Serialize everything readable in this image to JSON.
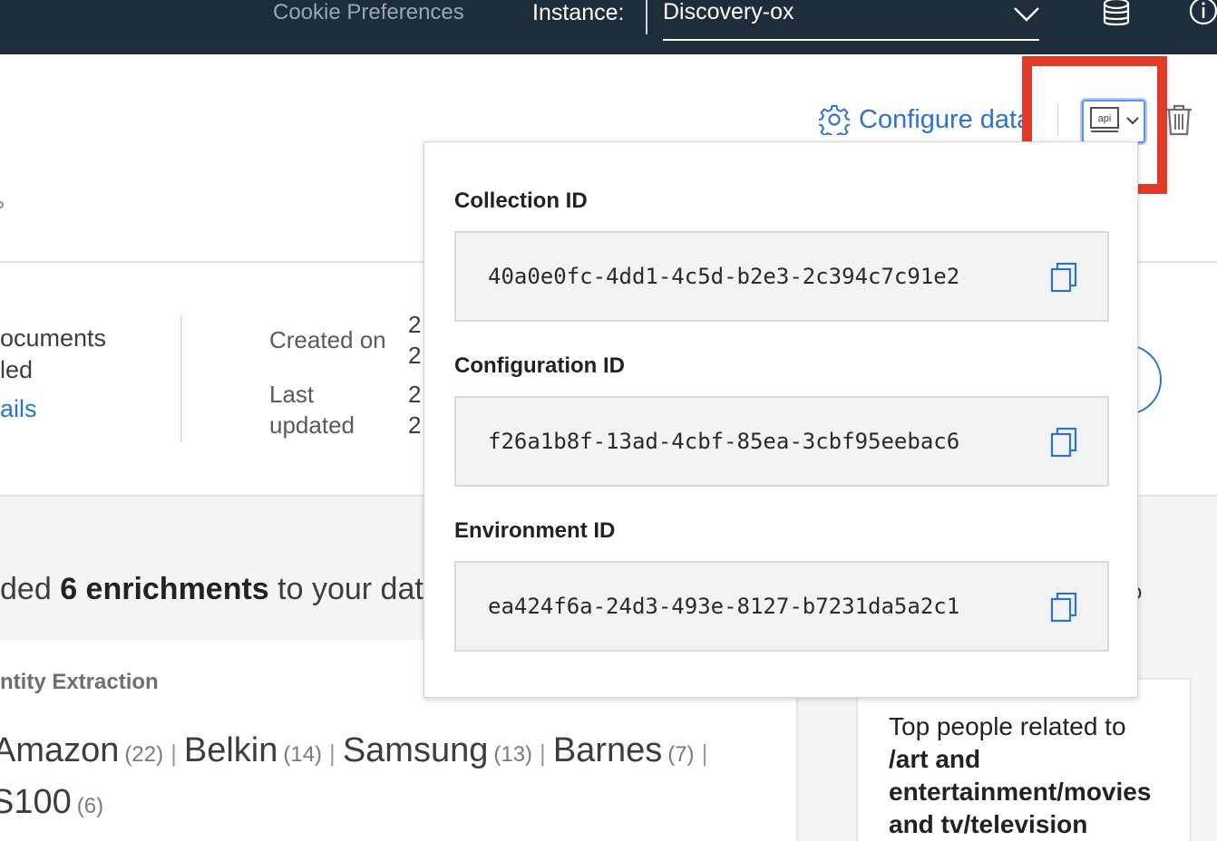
{
  "topbar": {
    "cookie_label": "Cookie Preferences",
    "instance_label": "Instance:",
    "instance_value": "Discovery-ox"
  },
  "actions": {
    "configure_label": "Configure data",
    "api_icon_text": "api"
  },
  "stats": {
    "docs_line1": "ocuments",
    "docs_line2": "led",
    "details_link": "ails",
    "created_label": "Created on",
    "created_val1": "2",
    "created_val2": "2",
    "updated_label1": "Last",
    "updated_label2": "updated",
    "updated_val1": "2",
    "updated_val2": "2"
  },
  "enrichments": {
    "prefix": "ded ",
    "bold": "6 enrichments",
    "suffix": " to your dat",
    "tail": "o"
  },
  "entities": {
    "title": "ntity Extraction",
    "items": [
      {
        "name": "Amazon",
        "count": "(22)"
      },
      {
        "name": "Belkin",
        "count": "(14)"
      },
      {
        "name": "Samsung",
        "count": "(13)"
      },
      {
        "name": "Barnes",
        "count": "(7)"
      },
      {
        "name": "S100",
        "count": "(6)"
      }
    ]
  },
  "top_card": {
    "line1": "Top people related to",
    "line2": "/art and entertainment/movies and tv/television"
  },
  "popover": {
    "collection_label": "Collection ID",
    "collection_id": "40a0e0fc-4dd1-4c5d-b2e3-2c394c7c91e2",
    "configuration_label": "Configuration ID",
    "configuration_id": "f26a1b8f-13ad-4cbf-85ea-3cbf95eebac6",
    "environment_label": "Environment ID",
    "environment_id": "ea424f6a-24d3-493e-8127-b7231da5a2c1"
  },
  "colors": {
    "topbar_bg": "#1e2d3b",
    "link_blue": "#2d74c9",
    "highlight_red": "#e23a28"
  }
}
